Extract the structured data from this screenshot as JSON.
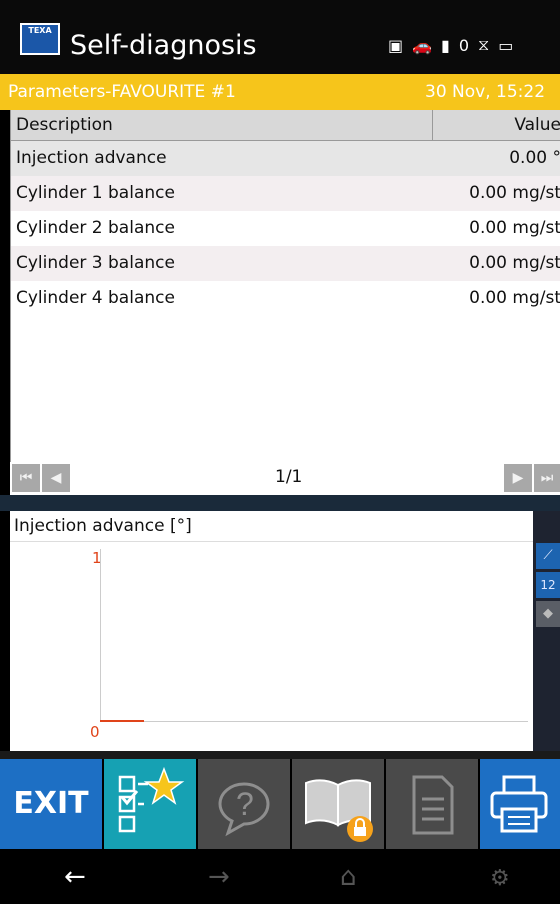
{
  "header": {
    "logo_text": "TEXA",
    "title": "Self-diagnosis",
    "status_icons": [
      "obd-connector-icon",
      "car-link-icon",
      "battery-charging-icon",
      "signal-zero-icon",
      "network-disconnected-icon",
      "battery-icon"
    ],
    "status_zero": "0"
  },
  "param_bar": {
    "label": "Parameters-FAVOURITE #1",
    "datetime": "30 Nov, 15:22"
  },
  "table": {
    "columns": {
      "description": "Description",
      "value": "Value"
    },
    "rows": [
      {
        "description": "Injection advance",
        "value": "0.00 °"
      },
      {
        "description": "Cylinder 1 balance",
        "value": "0.00 mg/st"
      },
      {
        "description": "Cylinder 2 balance",
        "value": "0.00 mg/st"
      },
      {
        "description": "Cylinder 3 balance",
        "value": "0.00 mg/st"
      },
      {
        "description": "Cylinder 4 balance",
        "value": "0.00 mg/st"
      }
    ]
  },
  "pager": {
    "label": "1/1"
  },
  "graph": {
    "title": "Injection advance [°]",
    "y_top": "1",
    "y_bottom": "0"
  },
  "toolbar": {
    "exit_label": "EXIT"
  },
  "colors": {
    "accent_yellow": "#f6c51b",
    "accent_blue": "#1d6fc4",
    "favourite_teal": "#16a1b3",
    "trace_orange": "#e0441a"
  }
}
